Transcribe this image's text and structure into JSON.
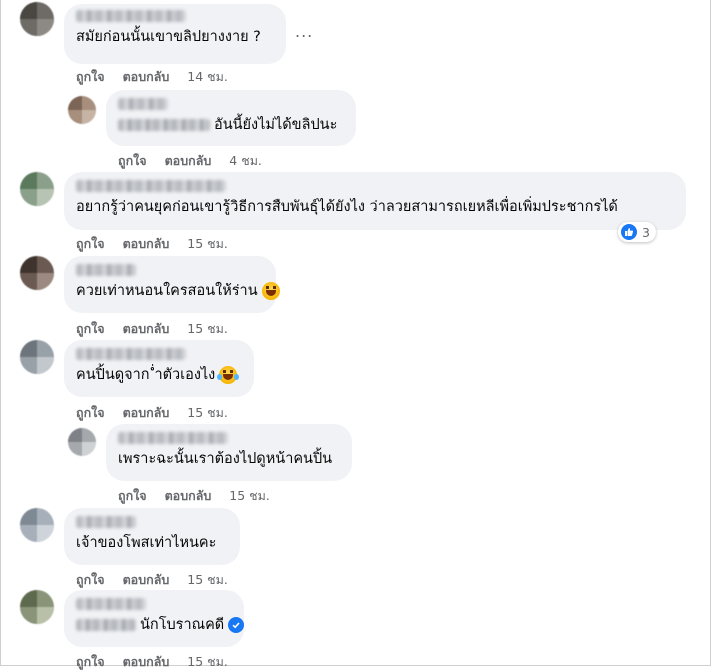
{
  "comments": [
    {
      "text": "สมัยก่อนนั้นเขาขลิปยางงาย ?",
      "like_label": "ถูกใจ",
      "reply_label": "ตอบกลับ",
      "time": "14 ชม.",
      "more_label": "..."
    },
    {
      "text": "อันนี้ยังไม่ได้ขลิปนะ",
      "like_label": "ถูกใจ",
      "reply_label": "ตอบกลับ",
      "time": "4 ชม."
    },
    {
      "text": "อยากรู้ว่าคนยุคก่อนเขารู้วิธีการสืบพันธุ์ได้ยังไง ว่าลวยสามารถเยหลีเพื่อเพิ่มประชากรได้",
      "like_label": "ถูกใจ",
      "reply_label": "ตอบกลับ",
      "time": "15 ชม.",
      "reaction_count": "3"
    },
    {
      "text": "ควยเท่าหนอนใครสอนให้ร่าน",
      "like_label": "ถูกใจ",
      "reply_label": "ตอบกลับ",
      "time": "15 ชม.",
      "emoji": "laughing-emoji"
    },
    {
      "text": "คนปิ้นดูจาก ่ำตัวเองไง",
      "like_label": "ถูกใจ",
      "reply_label": "ตอบกลับ",
      "time": "15 ชม.",
      "emoji": "tears-of-joy-emoji"
    },
    {
      "text": "เพราะฉะนั้นเราต้องไปดูหน้าคนปิ้น",
      "like_label": "ถูกใจ",
      "reply_label": "ตอบกลับ",
      "time": "15 ชม."
    },
    {
      "text": "เจ้าของโพสเท่าไหนคะ",
      "like_label": "ถูกใจ",
      "reply_label": "ตอบกลับ",
      "time": "15 ชม."
    },
    {
      "text": "นักโบราณคดี",
      "like_label": "ถูกใจ",
      "reply_label": "ตอบกลับ",
      "time": "15 ชม.",
      "badge": "verified-icon"
    }
  ],
  "colors": {
    "bubble": "#f0f2f5",
    "secondary_text": "#65676b",
    "accent": "#1877f2"
  }
}
